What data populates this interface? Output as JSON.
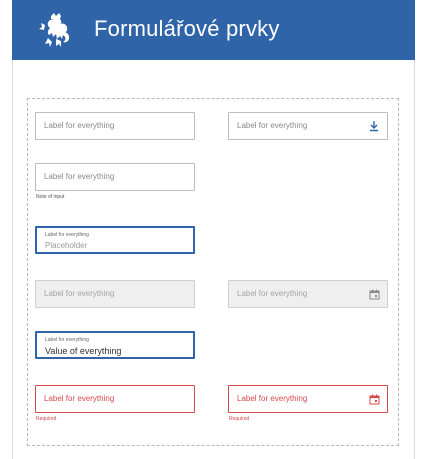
{
  "header": {
    "title": "Formulářové prvky",
    "background": "#2f64a8",
    "logo_icon": "czech-lion-emblem"
  },
  "fields": {
    "row1_left": {
      "label": "Label for everything"
    },
    "row1_right": {
      "label": "Label for everything",
      "icon": "download-icon"
    },
    "row2_left": {
      "label": "Label for everything",
      "note": "Note of input"
    },
    "row3_left": {
      "label": "Label for everything",
      "placeholder": "Placeholder"
    },
    "row4_left": {
      "label": "Label for everything"
    },
    "row4_right": {
      "label": "Label for everything",
      "icon": "calendar-icon"
    },
    "row5_left": {
      "label": "Label for everything",
      "value": "Value of everything"
    },
    "row6_left": {
      "label": "Label for everything",
      "note": "Required"
    },
    "row6_right": {
      "label": "Label for everything",
      "note": "Required",
      "icon": "calendar-icon"
    }
  },
  "colors": {
    "accent": "#2f64a8",
    "error": "#d84a4a",
    "disabled_bg": "#efefef"
  }
}
